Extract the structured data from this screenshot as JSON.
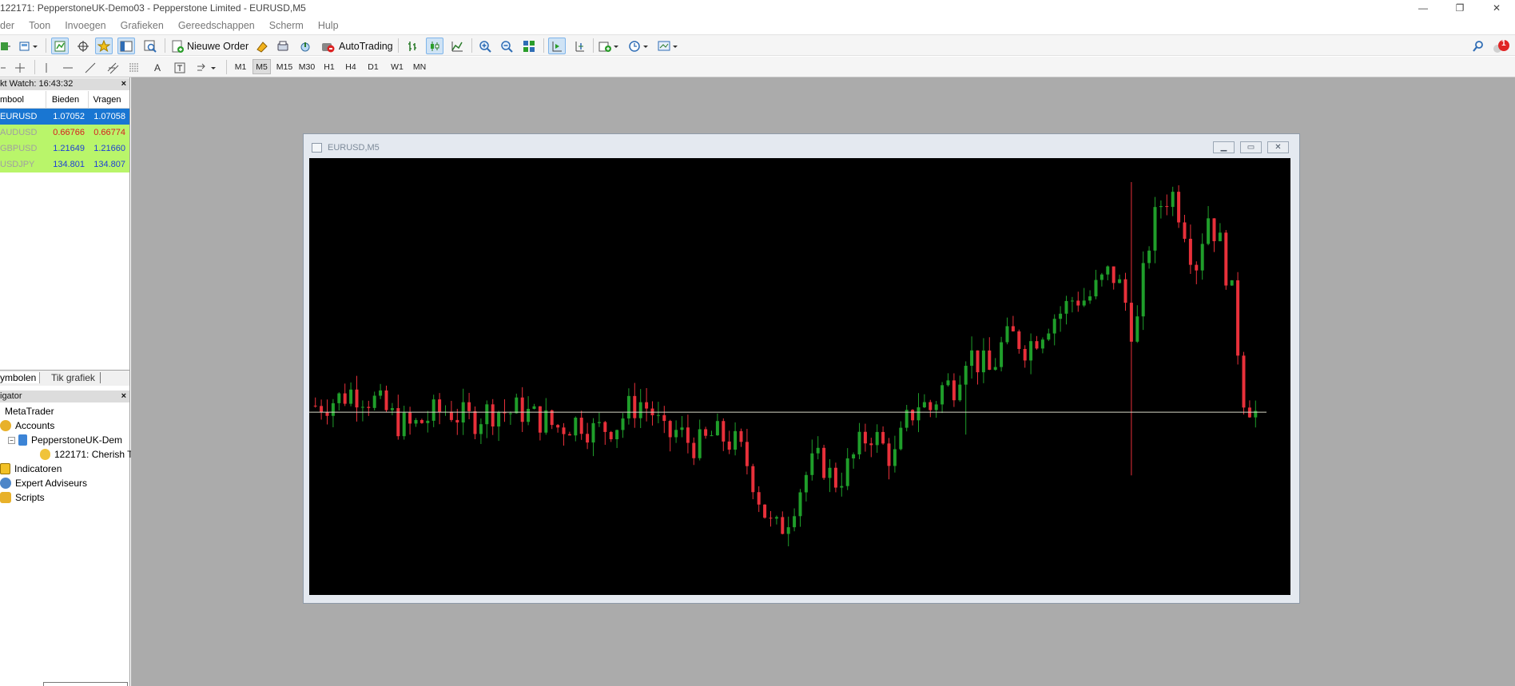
{
  "window": {
    "title": "122171: PepperstoneUK-Demo03 - Pepperstone Limited - EURUSD,M5",
    "controls": {
      "minimize": "—",
      "restore": "❐",
      "close": "✕"
    }
  },
  "menu": [
    "der",
    "Toon",
    "Invoegen",
    "Grafieken",
    "Gereedschappen",
    "Scherm",
    "Hulp"
  ],
  "toolbar": {
    "new_order_label": "Nieuwe Order",
    "autotrading_label": "AutoTrading",
    "notification_count": "1",
    "timeframes": [
      "M1",
      "M5",
      "M15",
      "M30",
      "H1",
      "H4",
      "D1",
      "W1",
      "MN"
    ],
    "active_timeframe": "M5"
  },
  "market_watch": {
    "header": "kt Watch: 16:43:32",
    "close": "×",
    "columns": [
      "mbool",
      "Bieden",
      "Vragen"
    ],
    "rows": [
      {
        "symbol": "EURUSD",
        "bid": "1.07052",
        "ask": "1.07058",
        "bg": "#1976d2",
        "fg": "#ffffff",
        "sym_color": "#ffffff",
        "bid_color": "#ffffff",
        "ask_color": "#ffffff"
      },
      {
        "symbol": "AUDUSD",
        "bid": "0.66766",
        "ask": "0.66774",
        "bg": "#b9f56a",
        "fg": "#000000",
        "sym_color": "#a0a0a0",
        "bid_color": "#d61f1f",
        "ask_color": "#d61f1f"
      },
      {
        "symbol": "GBPUSD",
        "bid": "1.21649",
        "ask": "1.21660",
        "bg": "#b9f56a",
        "fg": "#000000",
        "sym_color": "#a0a0a0",
        "bid_color": "#1f3fd6",
        "ask_color": "#1f3fd6"
      },
      {
        "symbol": "USDJPY",
        "bid": "134.801",
        "ask": "134.807",
        "bg": "#b9f56a",
        "fg": "#000000",
        "sym_color": "#a0a0a0",
        "bid_color": "#1f3fd6",
        "ask_color": "#1f3fd6"
      }
    ],
    "tabs": [
      "ymbolen",
      "Tik grafiek"
    ]
  },
  "navigator": {
    "header": "igator",
    "close": "×",
    "items": [
      {
        "label": "MetaTrader",
        "icon": "metatrader-icon"
      },
      {
        "label": "Accounts",
        "icon": "accounts-icon"
      },
      {
        "label": "PepperstoneUK-Dem",
        "icon": "server-icon"
      },
      {
        "label": "122171: Cherish T",
        "icon": "account-user-icon"
      },
      {
        "label": "Indicatoren",
        "icon": "indicators-icon"
      },
      {
        "label": "Expert Adviseurs",
        "icon": "experts-icon"
      },
      {
        "label": "Scripts",
        "icon": "scripts-icon"
      }
    ]
  },
  "chart_window": {
    "title": "EURUSD,M5",
    "colors": {
      "bull": "#1f9e2a",
      "bear": "#e8303a",
      "background": "#000000",
      "price_line": "#d8d8c8"
    }
  },
  "chart_data": {
    "type": "candlestick",
    "symbol": "EURUSD",
    "timeframe": "M5",
    "y_range": [
      1.0655,
      1.0775
    ],
    "current_price": 1.07052,
    "candles_close_path": [
      1.0707,
      1.0708,
      1.0709,
      1.0711,
      1.071,
      1.0708,
      1.0705,
      1.0702,
      1.0701,
      1.0703,
      1.0705,
      1.0706,
      1.0704,
      1.0703,
      1.0705,
      1.0706,
      1.0705,
      1.0706,
      1.0704,
      1.0703,
      1.0701,
      1.0702,
      1.0703,
      1.07,
      1.0701,
      1.0702,
      1.0706,
      1.0708,
      1.0705,
      1.0698,
      1.07,
      1.0697,
      1.0696,
      1.0699,
      1.0698,
      1.0696,
      1.069,
      1.068,
      1.0672,
      1.0675,
      1.0683,
      1.069,
      1.0692,
      1.0686,
      1.0689,
      1.0695,
      1.07,
      1.0696,
      1.0692,
      1.0702,
      1.0708,
      1.0706,
      1.0712,
      1.0713,
      1.0722,
      1.0719,
      1.0716,
      1.0724,
      1.0726,
      1.0723,
      1.0727,
      1.0731,
      1.0733,
      1.0737,
      1.0736,
      1.074,
      1.0744,
      1.0738,
      1.0725,
      1.075,
      1.0762,
      1.0766,
      1.0758,
      1.0745,
      1.076,
      1.0752,
      1.0738,
      1.071,
      1.0705
    ]
  }
}
